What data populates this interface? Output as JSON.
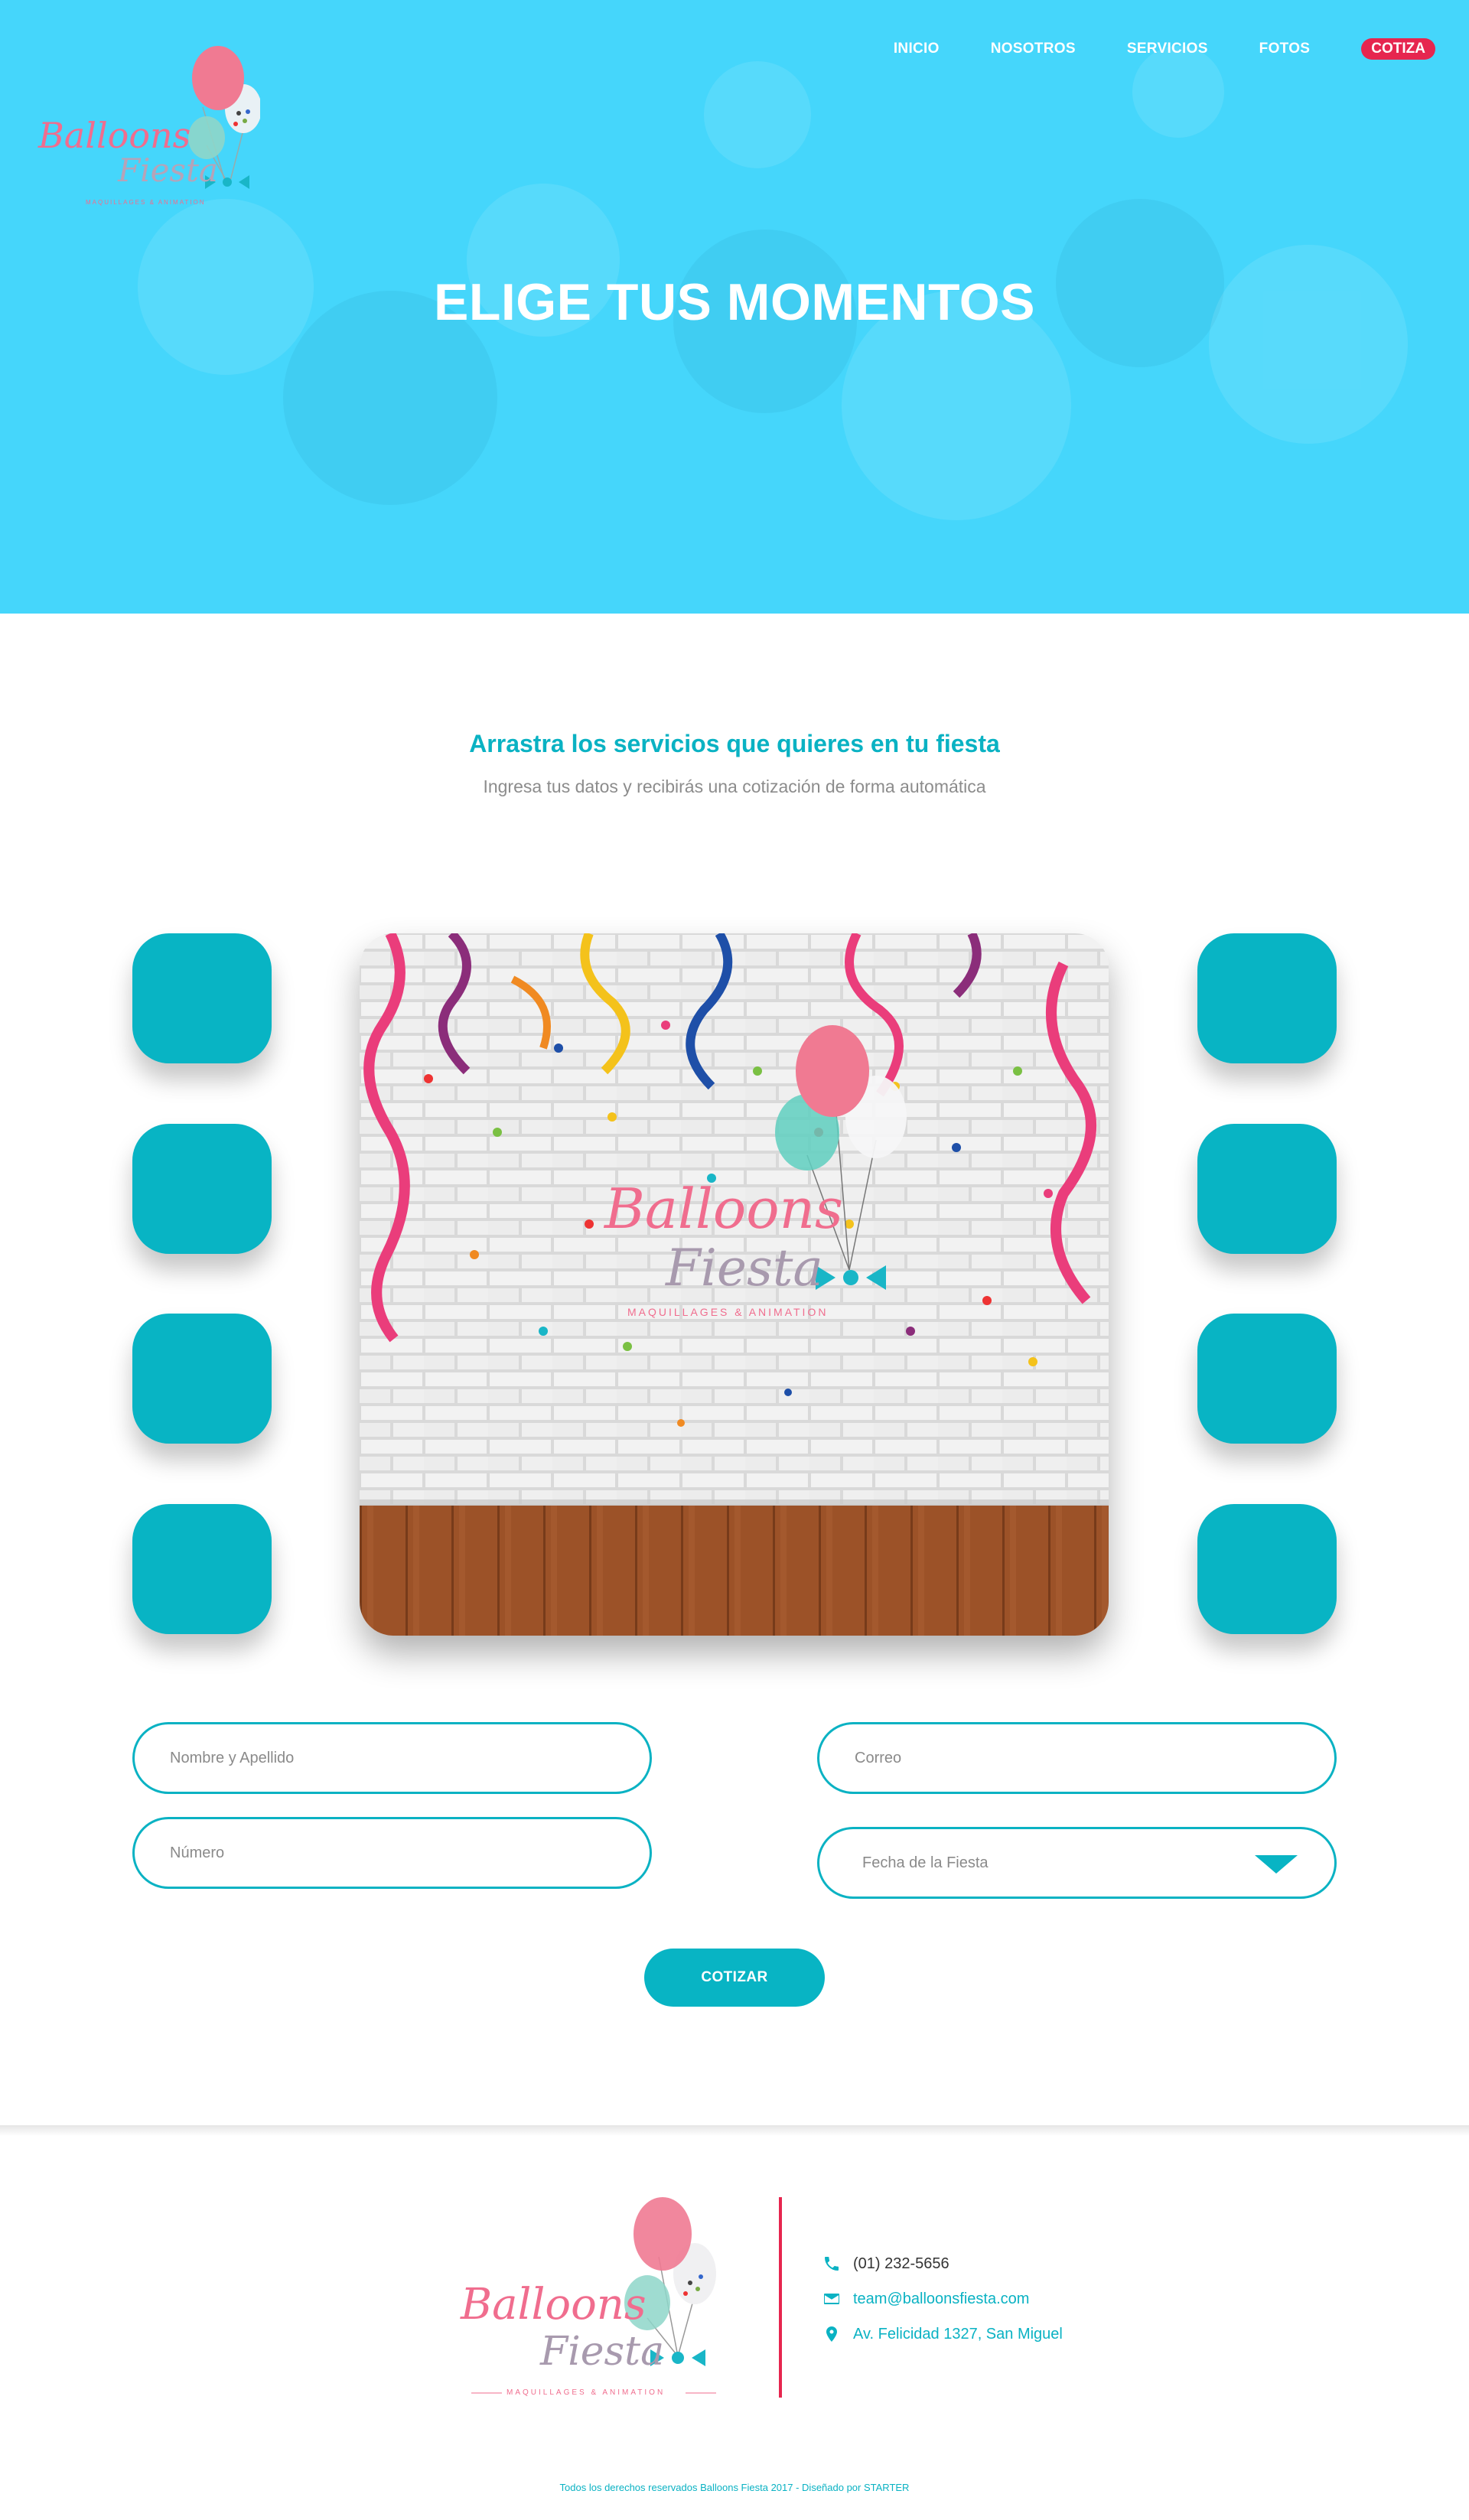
{
  "brand": {
    "logo_text_line1": "Balloons",
    "logo_text_line2": "Fiesta",
    "logo_tagline": "MAQUILLAGES & ANIMATION"
  },
  "nav": {
    "items": [
      {
        "label": "INICIO"
      },
      {
        "label": "NOSOTROS"
      },
      {
        "label": "SERVICIOS"
      },
      {
        "label": "FOTOS"
      }
    ],
    "cta_label": "COTIZA"
  },
  "hero": {
    "title": "ELIGE TUS MOMENTOS",
    "background_color": "#45d6fb"
  },
  "services": {
    "title": "Arrastra los servicios que quieres en tu fiesta",
    "subtitle": "Ingresa tus datos y recibirás una cotización de forma automática",
    "tile_color": "#08b4c4"
  },
  "form": {
    "name_placeholder": "Nombre y Apellido",
    "email_placeholder": "Correo",
    "phone_placeholder": "Número",
    "date_label": "Fecha de la Fiesta",
    "submit_label": "COTIZAR"
  },
  "footer": {
    "phone": "(01) 232-5656",
    "email": "team@balloonsfiesta.com",
    "address": "Av. Felicidad 1327, San Miguel",
    "copyright": "Todos los derechos reservados Balloons Fiesta 2017 - Diseñado por STARTER",
    "accent_color": "#e6264f"
  },
  "icons": [
    "phone-icon",
    "mail-icon",
    "location-pin-icon",
    "chevron-down-icon"
  ]
}
